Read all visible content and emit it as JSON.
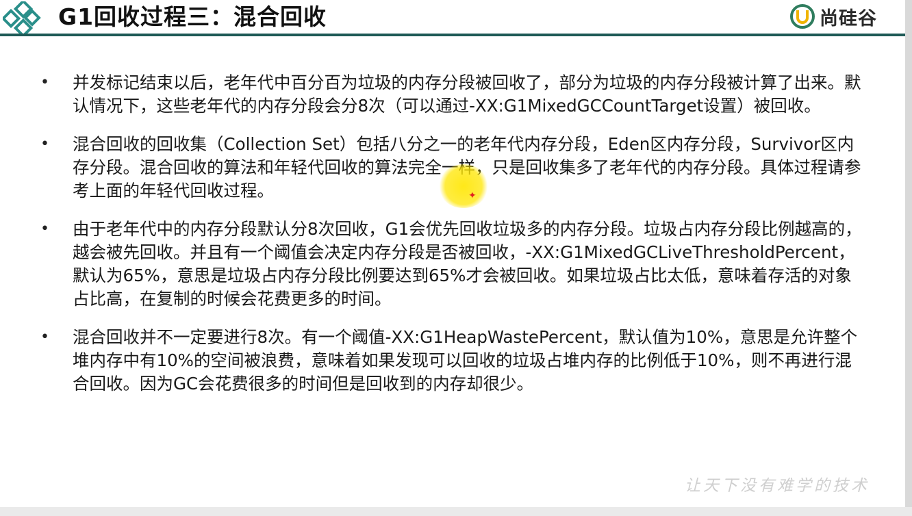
{
  "header": {
    "title": "G1回收过程三：混合回收",
    "brand_text": "尚硅谷",
    "colors": {
      "rule": "#1e5a56",
      "logo_teal": "#2a8f8a",
      "brand_ring": "#2f7d5e",
      "brand_accent": "#f0b400"
    }
  },
  "bullets": [
    {
      "symbol": "•",
      "text": "并发标记结束以后，老年代中百分百为垃圾的内存分段被回收了，部分为垃圾的内存分段被计算了出来。默认情况下，这些老年代的内存分段会分8次（可以通过-XX:G1MixedGCCountTarget设置）被回收。"
    },
    {
      "symbol": "•",
      "text": "混合回收的回收集（Collection Set）包括八分之一的老年代内存分段，Eden区内存分段，Survivor区内存分段。混合回收的算法和年轻代回收的算法完全一样，只是回收集多了老年代的内存分段。具体过程请参考上面的年轻代回收过程。"
    },
    {
      "symbol": "•",
      "text": "由于老年代中的内存分段默认分8次回收，G1会优先回收垃圾多的内存分段。垃圾占内存分段比例越高的，越会被先回收。并且有一个阈值会决定内存分段是否被回收，-XX:G1MixedGCLiveThresholdPercent，默认为65%，意思是垃圾占内存分段比例要达到65%才会被回收。如果垃圾占比太低，意味着存活的对象占比高，在复制的时候会花费更多的时间。"
    },
    {
      "symbol": "•",
      "text": "混合回收并不一定要进行8次。有一个阈值-XX:G1HeapWastePercent，默认值为10%，意思是允许整个堆内存中有10%的空间被浪费，意味着如果发现可以回收的垃圾占堆内存的比例低于10%，则不再进行混合回收。因为GC会花费很多的时间但是回收到的内存却很少。"
    }
  ],
  "watermark": "让天下没有难学的技术",
  "highlight": {
    "color": "#ffe600"
  }
}
